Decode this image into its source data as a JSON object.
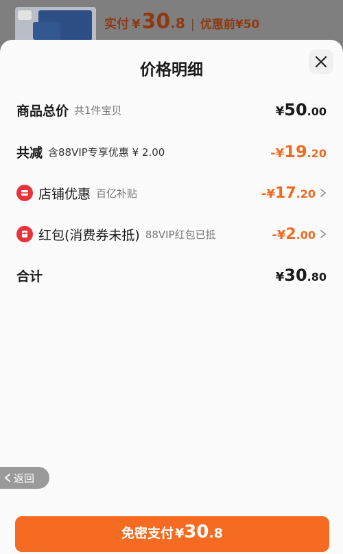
{
  "header_bar": {
    "label": "实付",
    "currency": "¥",
    "price_int": "30",
    "price_dec": ".8",
    "separator": "|",
    "original_label": "优惠前",
    "original_price": "¥50"
  },
  "sheet": {
    "title": "价格明细"
  },
  "rows": {
    "total": {
      "label": "商品总价",
      "sub": "共1件宝贝",
      "cur": "¥",
      "int": "50",
      "dec": ".00"
    },
    "discount": {
      "label": "共减",
      "sub": "含88VIP专享优惠 ¥ 2.00",
      "cur": "-¥",
      "int": "19",
      "dec": ".20"
    },
    "shop": {
      "label": "店铺优惠",
      "sub": "百亿补贴",
      "cur": "-¥",
      "int": "17",
      "dec": ".20"
    },
    "redpacket": {
      "label": "红包(消费券未抵)",
      "sub": "88VIP红包已抵",
      "cur": "-¥",
      "int": "2",
      "dec": ".00"
    },
    "sum": {
      "label": "合计",
      "cur": "¥",
      "int": "30",
      "dec": ".80"
    }
  },
  "back_button": {
    "label": "返回"
  },
  "pay_button": {
    "label": "免密支付",
    "cur": "¥",
    "int": "30",
    "dec": ".8"
  },
  "colors": {
    "accent": "#f56b22",
    "discount": "#f06a22",
    "icon_red": "#e8333a"
  },
  "icons": [
    "close-icon",
    "shop-discount-icon",
    "red-packet-icon",
    "chevron-right-icon",
    "chevron-left-icon"
  ]
}
